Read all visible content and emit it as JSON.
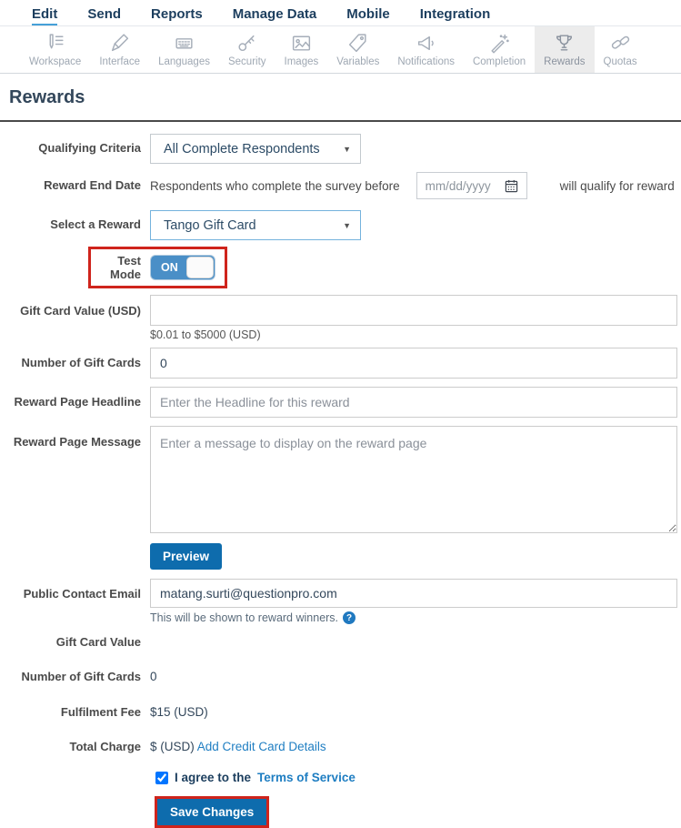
{
  "nav": {
    "items": [
      {
        "label": "Edit",
        "active": true
      },
      {
        "label": "Send",
        "active": false
      },
      {
        "label": "Reports",
        "active": false
      },
      {
        "label": "Manage Data",
        "active": false
      },
      {
        "label": "Mobile",
        "active": false
      },
      {
        "label": "Integration",
        "active": false
      }
    ]
  },
  "toolbar": {
    "items": [
      {
        "label": "Workspace",
        "icon": "workspace-icon",
        "selected": false
      },
      {
        "label": "Interface",
        "icon": "interface-icon",
        "selected": false
      },
      {
        "label": "Languages",
        "icon": "languages-icon",
        "selected": false
      },
      {
        "label": "Security",
        "icon": "security-icon",
        "selected": false
      },
      {
        "label": "Images",
        "icon": "images-icon",
        "selected": false
      },
      {
        "label": "Variables",
        "icon": "variables-icon",
        "selected": false
      },
      {
        "label": "Notifications",
        "icon": "notifications-icon",
        "selected": false
      },
      {
        "label": "Completion",
        "icon": "completion-icon",
        "selected": false
      },
      {
        "label": "Rewards",
        "icon": "rewards-icon",
        "selected": true
      },
      {
        "label": "Quotas",
        "icon": "quotas-icon",
        "selected": false
      }
    ]
  },
  "page": {
    "title": "Rewards"
  },
  "form": {
    "qualifying_criteria": {
      "label": "Qualifying Criteria",
      "value": "All Complete Respondents"
    },
    "reward_end_date": {
      "label": "Reward End Date",
      "prefix": "Respondents who complete the survey before",
      "placeholder": "mm/dd/yyyy",
      "suffix": "will qualify for reward"
    },
    "select_reward": {
      "label": "Select a Reward",
      "value": "Tango Gift Card"
    },
    "test_mode": {
      "label": "Test Mode",
      "state": "ON"
    },
    "gift_card_value": {
      "label": "Gift Card Value (USD)",
      "value": "",
      "helper": "$0.01 to $5000 (USD)"
    },
    "number_of_gift_cards": {
      "label": "Number of Gift Cards",
      "value": "0"
    },
    "reward_page_headline": {
      "label": "Reward Page Headline",
      "placeholder": "Enter the Headline for this reward"
    },
    "reward_page_message": {
      "label": "Reward Page Message",
      "placeholder": "Enter a message to display on the reward page"
    },
    "preview_button": "Preview",
    "public_contact_email": {
      "label": "Public Contact Email",
      "value": "matang.surti@questionpro.com",
      "helper": "This will be shown to reward winners."
    },
    "summary": [
      {
        "label": "Gift Card Value",
        "value": ""
      },
      {
        "label": "Number of Gift Cards",
        "value": "0"
      },
      {
        "label": "Fulfilment Fee",
        "value": "$15 (USD)"
      },
      {
        "label": "Total Charge",
        "value": "$ (USD)",
        "link": "Add Credit Card Details"
      }
    ],
    "agree": {
      "checked": true,
      "text": "I agree to the",
      "link": "Terms of Service"
    },
    "save_button": "Save Changes"
  },
  "colors": {
    "accent_blue": "#0e6cad",
    "toggle_blue": "#4a8fc7",
    "highlight_red": "#cf241c",
    "link_blue": "#1f7ec2",
    "nav_navy": "#1c3e5e"
  }
}
